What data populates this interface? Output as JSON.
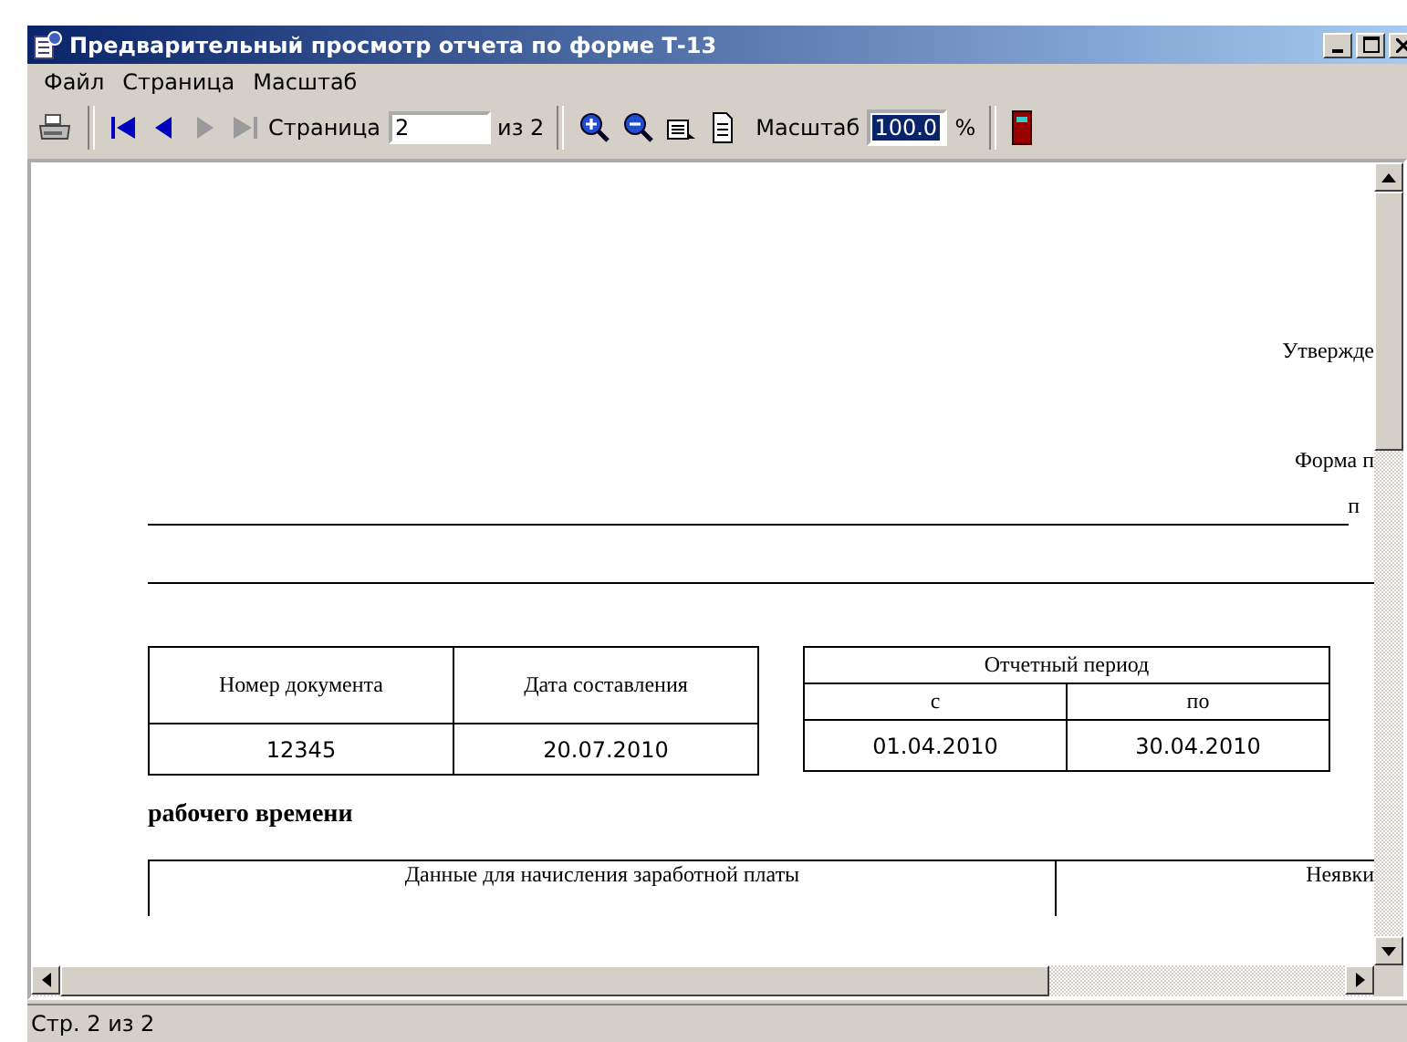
{
  "window": {
    "title": "Предварительный просмотр отчета по форме Т-13"
  },
  "menu": [
    {
      "label": "Файл"
    },
    {
      "label": "Страница"
    },
    {
      "label": "Масштаб"
    }
  ],
  "toolbar": {
    "nav": [
      {
        "kind": "first",
        "disabled": false
      },
      {
        "kind": "prev",
        "disabled": false
      },
      {
        "kind": "next",
        "disabled": true
      },
      {
        "kind": "last",
        "disabled": true
      }
    ],
    "page_label": "Страница",
    "page_value": "2",
    "page_total": "из 2",
    "scale_label": "Масштаб",
    "scale_value": "100.0",
    "scale_selected": true,
    "scale_unit": "%"
  },
  "document": {
    "approved": "Утвержде",
    "form": "Форма п",
    "form_line": "п",
    "doc_table": {
      "columns": [
        "Номер документа",
        "Дата составления"
      ],
      "values": [
        "12345",
        "20.07.2010"
      ]
    },
    "period_table": {
      "title": "Отчетный период",
      "columns": [
        "с",
        "по"
      ],
      "values": [
        "01.04.2010",
        "30.04.2010"
      ]
    },
    "heading": "рабочего времени",
    "bottom_table": {
      "columns": [
        "Данные для начисления заработной платы",
        "Неявки"
      ]
    }
  },
  "status_bar": "Стр. 2 из 2"
}
